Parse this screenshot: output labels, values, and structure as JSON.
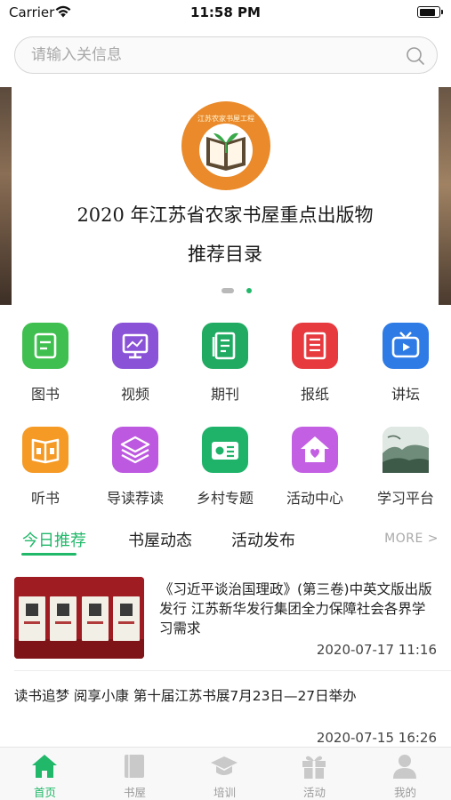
{
  "status_bar": {
    "carrier": "Carrier",
    "time": "11:58 PM",
    "battery_level": 0.85
  },
  "search": {
    "placeholder": "请输入关信息"
  },
  "banner": {
    "line1": "2020 年江苏省农家书屋重点出版物",
    "line2": "推荐目录",
    "logo_text": "江苏农家书屋工程",
    "page_count": 2,
    "active_page": 2
  },
  "grid": {
    "row1": [
      {
        "label": "图书",
        "icon": "book-icon",
        "color": "#3fbf4f"
      },
      {
        "label": "视频",
        "icon": "video-icon",
        "color": "#8a52d6"
      },
      {
        "label": "期刊",
        "icon": "journal-icon",
        "color": "#20aa62"
      },
      {
        "label": "报纸",
        "icon": "newspaper-icon",
        "color": "#e63a3f"
      },
      {
        "label": "讲坛",
        "icon": "tv-icon",
        "color": "#2e7be5"
      }
    ],
    "row2": [
      {
        "label": "听书",
        "icon": "audiobook-icon",
        "color": "#f59a25"
      },
      {
        "label": "导读荐读",
        "icon": "layers-icon",
        "color": "#bd59e0"
      },
      {
        "label": "乡村专题",
        "icon": "radio-icon",
        "color": "#1fb36a"
      },
      {
        "label": "活动中心",
        "icon": "home-icon",
        "color": "#c35fe3"
      },
      {
        "label": "学习平台",
        "icon": "landscape-icon",
        "color": "#6f8b7a"
      }
    ]
  },
  "tabs": {
    "items": [
      "今日推荐",
      "书屋动态",
      "活动发布"
    ],
    "more": "MORE >"
  },
  "news": [
    {
      "title": "《习近平谈治国理政》(第三卷)中英文版出版发行 江苏新华发行集团全力保障社会各界学习需求",
      "date": "2020-07-17 11:16"
    },
    {
      "title": "读书追梦 阅享小康 第十届江苏书展7月23日—27日举办",
      "date": "2020-07-15 16:26"
    }
  ],
  "bottom_nav": {
    "items": [
      "首页",
      "书屋",
      "培训",
      "活动",
      "我的"
    ],
    "active_color": "#21b86a",
    "inactive_color": "#9a9a9a"
  }
}
